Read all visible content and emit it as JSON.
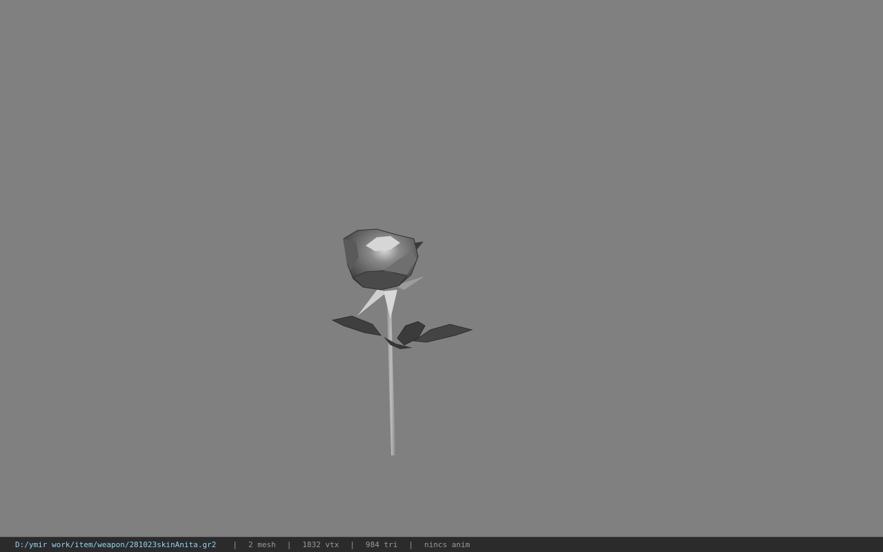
{
  "viewer": {
    "background_color": "#808080",
    "model_object": "rose-model"
  },
  "status": {
    "file_path": "D:/ymir work/item/weapon/281023skinAnita.gr2",
    "mesh": "2 mesh",
    "vertices": "1832 vtx",
    "triangles": "984 tri",
    "anim": "nincs anim",
    "separator": "|",
    "path_color": "#8fd3f4",
    "text_color": "#9a9a9a"
  }
}
